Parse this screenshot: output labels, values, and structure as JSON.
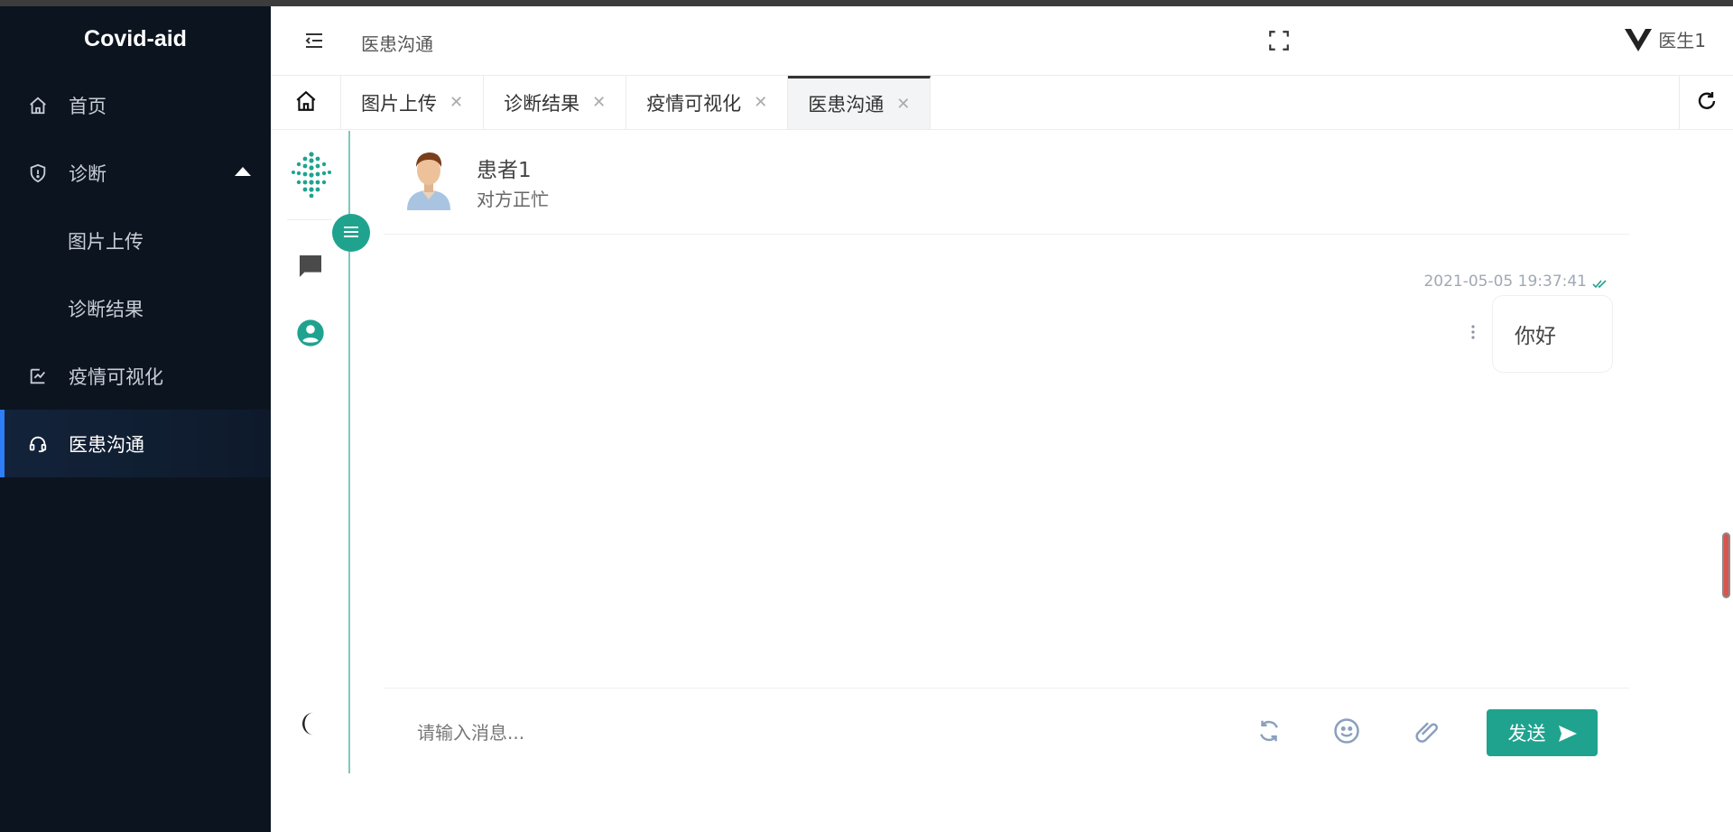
{
  "app": {
    "brand": "Covid-aid"
  },
  "sidebar": {
    "items": [
      {
        "label": "首页",
        "icon": "home-icon"
      },
      {
        "label": "诊断",
        "icon": "shield-icon",
        "expanded": true
      },
      {
        "label": "图片上传"
      },
      {
        "label": "诊断结果"
      },
      {
        "label": "疫情可视化",
        "icon": "chart-icon"
      },
      {
        "label": "医患沟通",
        "icon": "headset-icon",
        "active": true
      }
    ]
  },
  "header": {
    "breadcrumb": "医患沟通",
    "user_name": "医生1"
  },
  "tabs": [
    {
      "label": "图片上传"
    },
    {
      "label": "诊断结果"
    },
    {
      "label": "疫情可视化"
    },
    {
      "label": "医患沟通",
      "active": true
    }
  ],
  "chat": {
    "contact_name": "患者1",
    "contact_status": "对方正忙",
    "messages": [
      {
        "time": "2021-05-05 19:37:41",
        "text": "你好",
        "read": true
      }
    ],
    "composer": {
      "placeholder": "请输入消息...",
      "send_label": "发送"
    }
  },
  "colors": {
    "accent": "#1fa38f",
    "sidebar_bg": "#0c1420",
    "active_bar": "#2d7ef7"
  }
}
